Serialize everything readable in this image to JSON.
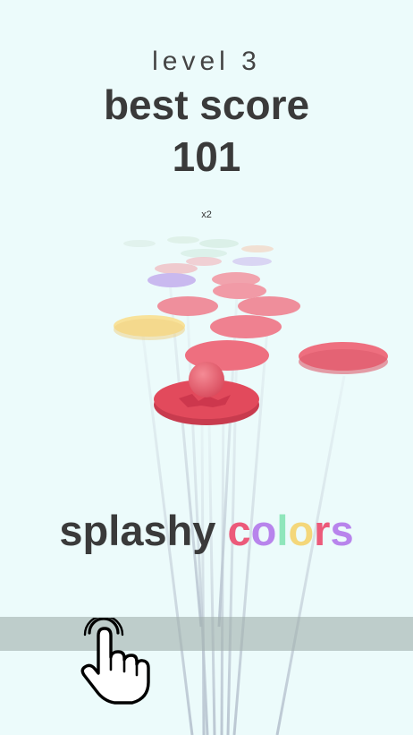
{
  "hud": {
    "level_text": "level 3",
    "best_score_label": "best score",
    "best_score_value": "101",
    "multiplier": "x2"
  },
  "title": {
    "word1": "splashy",
    "word2_letters": [
      {
        "ch": "c",
        "color": "#ec5a7a"
      },
      {
        "ch": "o",
        "color": "#b884ec"
      },
      {
        "ch": "l",
        "color": "#8fe6bb"
      },
      {
        "ch": "o",
        "color": "#f4d77a"
      },
      {
        "ch": "r",
        "color": "#ec5a7a"
      },
      {
        "ch": "s",
        "color": "#b884ec"
      }
    ]
  },
  "colors": {
    "background": "#ecfbfb",
    "pink_platform": "#ee6f7f",
    "active_platform": "#e24a5c",
    "ball": "#ea5f6f",
    "yellow_platform": "#f8e29a",
    "lilac_platform": "#c6b7ee",
    "pole": "#bcc7d2"
  },
  "icons": {
    "tutorial_hand": "tap-hand-icon"
  }
}
